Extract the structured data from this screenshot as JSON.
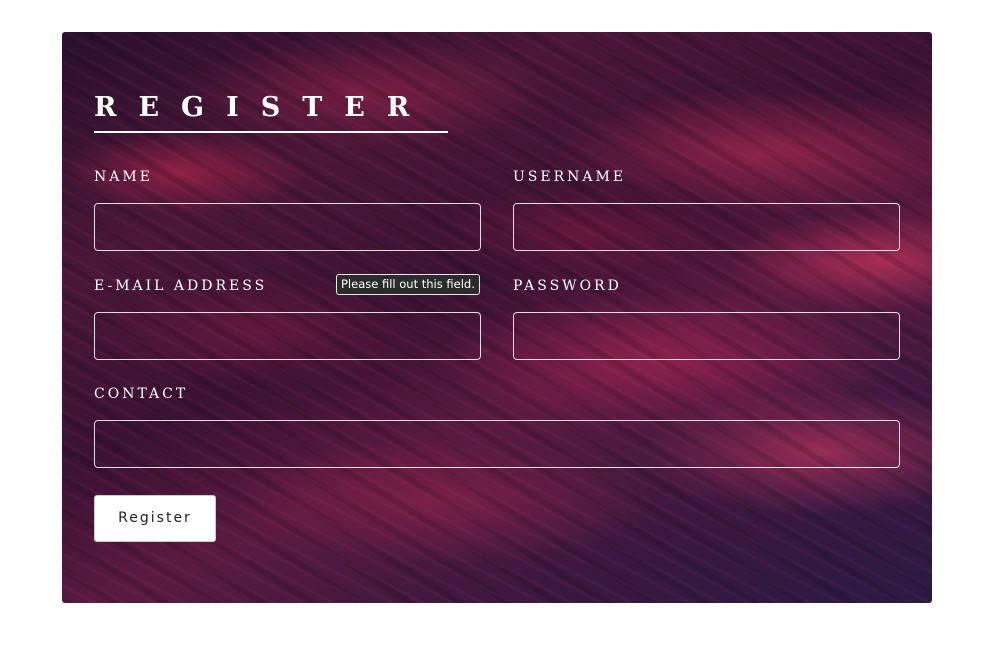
{
  "form": {
    "title": "REGISTER",
    "fields": {
      "name": {
        "label": "NAME",
        "value": ""
      },
      "username": {
        "label": "USERNAME",
        "value": ""
      },
      "email": {
        "label": "E-MAIL ADDRESS",
        "value": ""
      },
      "password": {
        "label": "PASSWORD",
        "value": ""
      },
      "contact": {
        "label": "CONTACT",
        "value": ""
      }
    },
    "validation_tooltip": "Please fill out this field.",
    "submit_label": "Register"
  },
  "colors": {
    "page_background": "#ffffff",
    "card_base": "#3a1234",
    "accent": "#d63a64",
    "text": "#ffffff"
  }
}
